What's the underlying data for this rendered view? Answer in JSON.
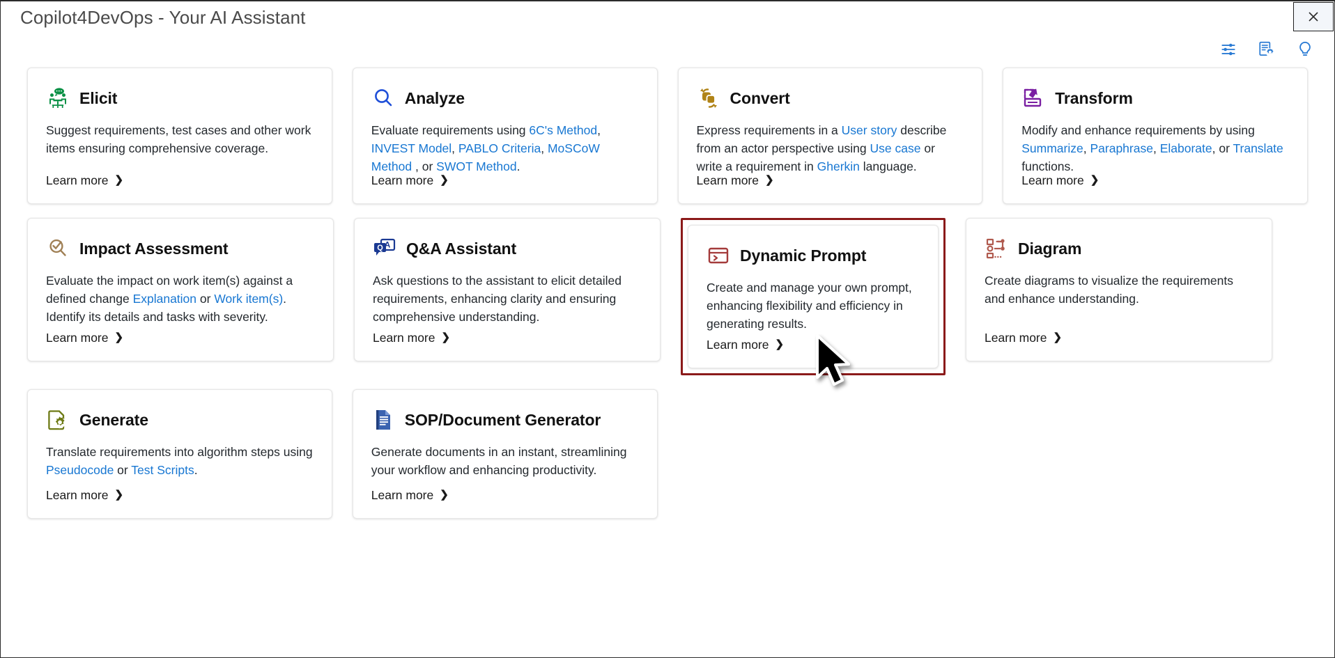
{
  "window": {
    "title": "Copilot4DevOps - Your AI Assistant",
    "close_label": "✕"
  },
  "toolbar": {
    "icons": [
      {
        "name": "settings-sliders-icon",
        "label": "Settings"
      },
      {
        "name": "document-settings-icon",
        "label": "Document Settings"
      },
      {
        "name": "lightbulb-icon",
        "label": "Tips"
      }
    ],
    "accent_color": "#2a7bd4"
  },
  "common": {
    "learn_more": "Learn more",
    "chevron": "❯"
  },
  "colors": {
    "link": "#1877d2",
    "highlight_border": "#8b1a1a",
    "elicit": "#0a9045",
    "analyze": "#1f4fd8",
    "convert": "#b08316",
    "transform": "#7a1fa2",
    "impact": "#a08055",
    "qa": "#1b3a93",
    "dynamic_prompt": "#a43b3b",
    "diagram": "#b05a4e",
    "generate": "#6d7a15",
    "sop": "#2a4c96"
  },
  "cards": [
    {
      "id": "elicit",
      "icon": "elicit-meeting-icon",
      "title": "Elicit",
      "desc_parts": [
        {
          "t": "Suggest requirements, test cases and other work items ensuring comprehensive coverage.",
          "link": false
        }
      ],
      "learn_more": "Learn more"
    },
    {
      "id": "analyze",
      "icon": "analyze-search-icon",
      "title": "Analyze",
      "desc_parts": [
        {
          "t": "Evaluate requirements using ",
          "link": false
        },
        {
          "t": "6C's Method",
          "link": true
        },
        {
          "t": ", ",
          "link": false
        },
        {
          "t": "INVEST Model",
          "link": true
        },
        {
          "t": ", ",
          "link": false
        },
        {
          "t": "PABLO Criteria",
          "link": true
        },
        {
          "t": ", ",
          "link": false
        },
        {
          "t": "MoSCoW Method",
          "link": true
        },
        {
          "t": " , or ",
          "link": false
        },
        {
          "t": "SWOT Method",
          "link": true
        },
        {
          "t": ".",
          "link": false
        }
      ],
      "learn_more": "Learn more"
    },
    {
      "id": "convert",
      "icon": "convert-rotate-icon",
      "title": "Convert",
      "desc_parts": [
        {
          "t": "Express requirements in a ",
          "link": false
        },
        {
          "t": "User story",
          "link": true
        },
        {
          "t": "  describe from an actor perspective using ",
          "link": false
        },
        {
          "t": "Use case",
          "link": true
        },
        {
          "t": "  or write a requirement in ",
          "link": false
        },
        {
          "t": "Gherkin",
          "link": true
        },
        {
          "t": "  language.",
          "link": false
        }
      ],
      "learn_more": "Learn more"
    },
    {
      "id": "transform",
      "icon": "transform-export-icon",
      "title": "Transform",
      "desc_parts": [
        {
          "t": "Modify and enhance requirements by using ",
          "link": false
        },
        {
          "t": "Summarize",
          "link": true
        },
        {
          "t": ", ",
          "link": false
        },
        {
          "t": "Paraphrase",
          "link": true
        },
        {
          "t": ", ",
          "link": false
        },
        {
          "t": "Elaborate",
          "link": true
        },
        {
          "t": ", or ",
          "link": false
        },
        {
          "t": "Translate",
          "link": true
        },
        {
          "t": " functions.",
          "link": false
        }
      ],
      "learn_more": "Learn more"
    },
    {
      "id": "impact-assessment",
      "icon": "impact-magnifier-check-icon",
      "title": "Impact Assessment",
      "desc_parts": [
        {
          "t": "Evaluate the impact on work item(s) against a defined change ",
          "link": false
        },
        {
          "t": "Explanation",
          "link": true
        },
        {
          "t": " or ",
          "link": false
        },
        {
          "t": "Work item(s)",
          "link": true
        },
        {
          "t": ". Identify its details and tasks with severity.",
          "link": false
        }
      ],
      "learn_more": "Learn more"
    },
    {
      "id": "qa-assistant",
      "icon": "qa-chat-icon",
      "title": "Q&A Assistant",
      "desc_parts": [
        {
          "t": "Ask questions to the assistant to elicit detailed requirements, enhancing clarity and ensuring comprehensive understanding.",
          "link": false
        }
      ],
      "learn_more": "Learn more"
    },
    {
      "id": "dynamic-prompt",
      "icon": "dynamic-prompt-console-icon",
      "title": "Dynamic Prompt",
      "highlighted": true,
      "desc_parts": [
        {
          "t": "Create and manage your own prompt, enhancing flexibility and efficiency in generating results.",
          "link": false
        }
      ],
      "learn_more": "Learn more"
    },
    {
      "id": "diagram",
      "icon": "diagram-nodes-icon",
      "title": "Diagram",
      "desc_parts": [
        {
          "t": "Create diagrams to visualize the requirements and enhance understanding.",
          "link": false
        }
      ],
      "learn_more": "Learn more"
    },
    {
      "id": "generate",
      "icon": "generate-doc-gear-icon",
      "title": "Generate",
      "desc_parts": [
        {
          "t": "Translate requirements into algorithm steps using ",
          "link": false
        },
        {
          "t": "Pseudocode",
          "link": true
        },
        {
          "t": " or ",
          "link": false
        },
        {
          "t": "Test Scripts",
          "link": true
        },
        {
          "t": ".",
          "link": false
        }
      ],
      "learn_more": "Learn more"
    },
    {
      "id": "sop-document-generator",
      "icon": "sop-document-icon",
      "title": "SOP/Document Generator",
      "desc_parts": [
        {
          "t": "Generate documents in an instant, streamlining your workflow and enhancing productivity.",
          "link": false
        }
      ],
      "learn_more": "Learn more"
    }
  ]
}
